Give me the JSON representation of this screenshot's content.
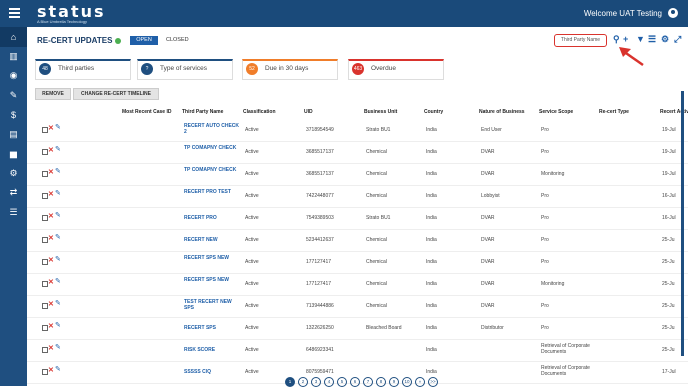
{
  "header": {
    "logo_text": "status",
    "logo_subtitle": "A Blue Umbrella Technology",
    "welcome": "Welcome UAT Testing"
  },
  "sidebar": {
    "items": [
      {
        "name": "home-icon",
        "glyph": "⌂"
      },
      {
        "name": "building-icon",
        "glyph": "▥"
      },
      {
        "name": "eye-icon",
        "glyph": "◉"
      },
      {
        "name": "edit-document-icon",
        "glyph": "✎"
      },
      {
        "name": "dollar-icon",
        "glyph": "$"
      },
      {
        "name": "document-icon",
        "glyph": "▤"
      },
      {
        "name": "chart-icon",
        "glyph": "▅"
      },
      {
        "name": "gear-icon",
        "glyph": "⚙"
      },
      {
        "name": "transfer-icon",
        "glyph": "⇄"
      },
      {
        "name": "list-icon",
        "glyph": "☰"
      }
    ]
  },
  "page": {
    "title": "RE-CERT UPDATES",
    "open_label": "OPEN",
    "closed_label": "CLOSED",
    "search_placeholder": "Third Party Name"
  },
  "cards": [
    {
      "count": "48",
      "label": "Third parties",
      "color": "#1f4f80"
    },
    {
      "count": "?",
      "label": "Type of services",
      "color": "#1f4f80"
    },
    {
      "count": "52",
      "label": "Due in 30 days",
      "color": "#f07d2a"
    },
    {
      "count": "463",
      "label": "Overdue",
      "color": "#d9332d"
    }
  ],
  "actions": {
    "remove": "REMOVE",
    "change_timeline": "CHANGE RE-CERT TIMELINE"
  },
  "table": {
    "headers": [
      "Most Recent Case ID",
      "Third Party Name",
      "Classification",
      "UID",
      "Business Unit",
      "Country",
      "Nature of Business",
      "Service Scope",
      "Re-cert Type",
      "Recert Activat"
    ],
    "rows": [
      {
        "name": "RECERT AUTO CHECK 2",
        "cls": "Active",
        "uid": "3718954549",
        "bu": "Strato BU1",
        "country": "India",
        "nob": "End User",
        "scope": "Pro",
        "date": "19-Jul"
      },
      {
        "name": "TP COMAPNY CHECK",
        "cls": "Active",
        "uid": "3685517137",
        "bu": "Chemical",
        "country": "India",
        "nob": "DVAR",
        "scope": "Pro",
        "date": "19-Jul"
      },
      {
        "name": "TP COMAPNY CHECK",
        "cls": "Active",
        "uid": "3685517137",
        "bu": "Chemical",
        "country": "India",
        "nob": "DVAR",
        "scope": "Monitoring",
        "date": "19-Jul"
      },
      {
        "name": "RECERT PRO TEST",
        "cls": "Active",
        "uid": "7422448077",
        "bu": "Chemical",
        "country": "India",
        "nob": "Lobbyist",
        "scope": "Pro",
        "date": "16-Jul"
      },
      {
        "name": "RECERT PRO",
        "cls": "Active",
        "uid": "7549389503",
        "bu": "Strato BU1",
        "country": "India",
        "nob": "DVAR",
        "scope": "Pro",
        "date": "16-Jul"
      },
      {
        "name": "RECERT NEW",
        "cls": "Active",
        "uid": "5234412637",
        "bu": "Chemical",
        "country": "India",
        "nob": "DVAR",
        "scope": "Pro",
        "date": "25-Ju"
      },
      {
        "name": "RECERT SPS NEW",
        "cls": "Active",
        "uid": "177127417",
        "bu": "Chemical",
        "country": "India",
        "nob": "DVAR",
        "scope": "Pro",
        "date": "25-Ju"
      },
      {
        "name": "RECERT SPS NEW",
        "cls": "Active",
        "uid": "177127417",
        "bu": "Chemical",
        "country": "India",
        "nob": "DVAR",
        "scope": "Monitoring",
        "date": "25-Ju"
      },
      {
        "name": "TEST RECERT NEW SPS",
        "cls": "Active",
        "uid": "7139444886",
        "bu": "Chemical",
        "country": "India",
        "nob": "DVAR",
        "scope": "Pro",
        "date": "25-Ju"
      },
      {
        "name": "RECERT SPS",
        "cls": "Active",
        "uid": "1322626250",
        "bu": "Bleached Board",
        "country": "India",
        "nob": "Distributor",
        "scope": "Pro",
        "date": "25-Ju"
      },
      {
        "name": "RISK SCORE",
        "cls": "Active",
        "uid": "6486923341",
        "bu": "",
        "country": "India",
        "nob": "",
        "scope": "Retrieval of Corporate Documents",
        "date": "25-Ju"
      },
      {
        "name": "SSSSS CIQ",
        "cls": "Active",
        "uid": "8075959471",
        "bu": "",
        "country": "India",
        "nob": "",
        "scope": "Retrieval of Corporate Documents",
        "date": "17-Jul"
      }
    ]
  },
  "pager": [
    "1",
    "2",
    "3",
    "4",
    "5",
    "6",
    "7",
    "8",
    "9",
    "10",
    "»",
    ">>"
  ]
}
